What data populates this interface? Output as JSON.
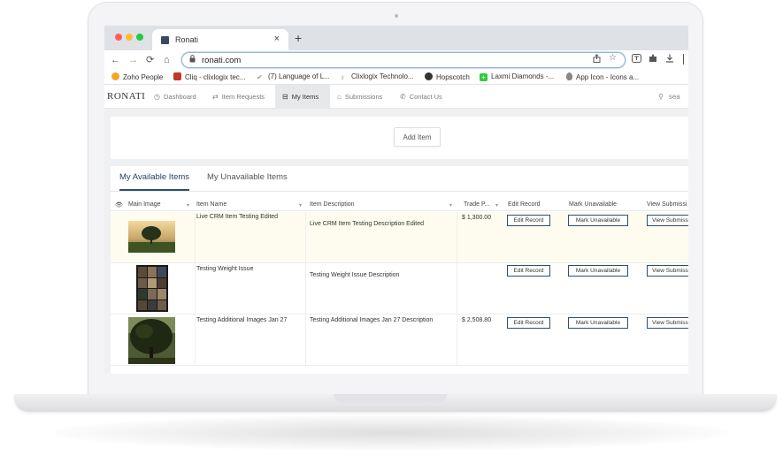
{
  "browser": {
    "tab_title": "Ronati",
    "tab_close": "×",
    "new_tab": "+",
    "url": "ronati.com",
    "nav_icons": {
      "back": "←",
      "forward": "→",
      "reload": "⟳",
      "home": "⌂"
    },
    "bookmarks": [
      {
        "label": "Zoho People",
        "icon": "zoho-icon",
        "color": "#f5a623"
      },
      {
        "label": "Cliq - clixlogix tec...",
        "icon": "cliq-icon",
        "color": "#c0392b"
      },
      {
        "label": "(7) Language of L...",
        "icon": "check-icon",
        "color": "#999999"
      },
      {
        "label": "Clixlogix Technolo...",
        "icon": "bulb-icon",
        "color": "#7a7a7a"
      },
      {
        "label": "Hopscotch",
        "icon": "globe-icon",
        "color": "#333333"
      },
      {
        "label": "Laxmi Diamonds -...",
        "icon": "plus-icon",
        "color": "#2ecc40"
      },
      {
        "label": "App Icon - Icons a...",
        "icon": "apple-icon",
        "color": "#777777"
      }
    ]
  },
  "app": {
    "brand": "RONATI",
    "nav": [
      {
        "label": "Dashboard",
        "icon": "dashboard-icon"
      },
      {
        "label": "Item Requests",
        "icon": "requests-icon"
      },
      {
        "label": "My Items",
        "icon": "items-icon",
        "active": true
      },
      {
        "label": "Submissions",
        "icon": "submissions-icon"
      },
      {
        "label": "Contact Us",
        "icon": "phone-icon"
      }
    ],
    "search_label": "sea",
    "add_item": "Add Item",
    "tabs": [
      {
        "label": "My Available Items",
        "active": true
      },
      {
        "label": "My Unavailable Items",
        "active": false
      }
    ],
    "columns": [
      "Main Image",
      "Item Name",
      "Item Description",
      "Trade P...",
      "Edit Record",
      "Mark Unavailable",
      "View Submissi"
    ],
    "rows": [
      {
        "name": "Live CRM Item Testing Edited",
        "description": "Live CRM Item Testing Description Edited",
        "price": "$ 1,300.00",
        "edit": "Edit Record",
        "mark": "Mark Unavailable",
        "view": "View Submiss",
        "highlight": true,
        "image": "tree-field-image"
      },
      {
        "name": "Testing Weight Issue",
        "description": "Testing Weight Issue Description",
        "price": "",
        "edit": "Edit Record",
        "mark": "Mark Unavailable",
        "view": "View Submiss",
        "highlight": false,
        "image": "collage-image"
      },
      {
        "name": "Testing Additional Images Jan 27",
        "description": "Testing Additional Images Jan 27 Description",
        "price": "$ 2,508.80",
        "edit": "Edit Record",
        "mark": "Mark Unavailable",
        "view": "View Submiss",
        "highlight": false,
        "image": "tree-image"
      }
    ]
  }
}
